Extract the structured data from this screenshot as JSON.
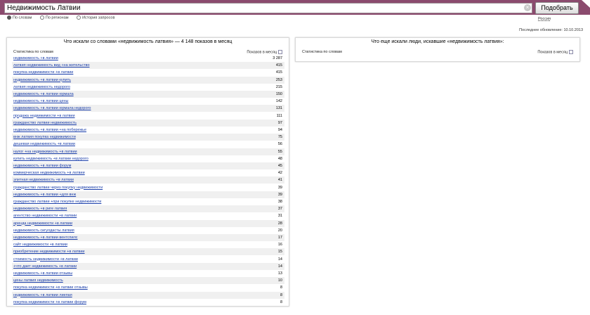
{
  "search": {
    "query": "Недвижимость Латвии",
    "submit_label": "Подобрать",
    "clear_icon": "close-icon"
  },
  "modes": [
    {
      "label": "По словам",
      "selected": true
    },
    {
      "label": "По регионам",
      "selected": false
    },
    {
      "label": "История запросов",
      "selected": false
    }
  ],
  "region": "Россия",
  "updated": "Последнее обновление: 10.10.2013",
  "left": {
    "title": "Что искали со словами «недвижимость латвия» — 4 148 показов в месяц",
    "col_keywords": "Статистика по словам",
    "col_views": "Показов в месяц",
    "export_icon": "export-icon",
    "rows": [
      {
        "keyword": "недвижимость +в латвии",
        "count": "3 287"
      },
      {
        "keyword": "латвия недвижимость вид +на жительство",
        "count": "415"
      },
      {
        "keyword": "покупка недвижимости +в латвии",
        "count": "415"
      },
      {
        "keyword": "недвижимость +в латвии купить",
        "count": "253"
      },
      {
        "keyword": "латвия недвижимость недорого",
        "count": "215"
      },
      {
        "keyword": "недвижимость +в латвии юрмала",
        "count": "150"
      },
      {
        "keyword": "недвижимость +в латвии цены",
        "count": "142"
      },
      {
        "keyword": "недвижимость +в латвии юрмала недорого",
        "count": "131"
      },
      {
        "keyword": "продажа недвижимости +в латвии",
        "count": "111"
      },
      {
        "keyword": "гражданство латвии недвижимость",
        "count": "97"
      },
      {
        "keyword": "недвижимость +в латвии +на побережье",
        "count": "94"
      },
      {
        "keyword": "внж латвия покупка недвижимости",
        "count": "75"
      },
      {
        "keyword": "дешевая недвижимость +в латвии",
        "count": "56"
      },
      {
        "keyword": "налог +на недвижимость +в латвии",
        "count": "55"
      },
      {
        "keyword": "купить недвижимость +в латвии недорого",
        "count": "48"
      },
      {
        "keyword": "недвижимость +в латвии форум",
        "count": "45"
      },
      {
        "keyword": "коммерческая недвижимость +в латвии",
        "count": "42"
      },
      {
        "keyword": "элитная недвижимость +в латвии",
        "count": "41"
      },
      {
        "keyword": "гражданство латвии через покупку недвижимости",
        "count": "39"
      },
      {
        "keyword": "недвижимость +в латвии +для внж",
        "count": "39"
      },
      {
        "keyword": "гражданство латвии +при покупке недвижимости",
        "count": "38"
      },
      {
        "keyword": "недвижимость +в риге латвия",
        "count": "37"
      },
      {
        "keyword": "агентство недвижимости +в латвии",
        "count": "31"
      },
      {
        "keyword": "аренда недвижимости +в латвии",
        "count": "28"
      },
      {
        "keyword": "недвижимость сигулдасты латвия",
        "count": "20"
      },
      {
        "keyword": "недвижимость +в латвии вентспилс",
        "count": "17"
      },
      {
        "keyword": "сайт недвижимости +в латвии",
        "count": "16"
      },
      {
        "keyword": "приобретение недвижимости +в латвии",
        "count": "15"
      },
      {
        "keyword": "стоимость недвижимости +в латвии",
        "count": "14"
      },
      {
        "keyword": "+что дает недвижимость +в латвии",
        "count": "14"
      },
      {
        "keyword": "недвижимость +в латвии отзывы",
        "count": "13"
      },
      {
        "keyword": "цены латвия недвижимость",
        "count": "10"
      },
      {
        "keyword": "покупка недвижимости +в латвии отзывы",
        "count": "8"
      },
      {
        "keyword": "недвижимость +в латвии лиепая",
        "count": "8"
      },
      {
        "keyword": "покупка недвижимости +в латвии форум",
        "count": "8"
      }
    ]
  },
  "right": {
    "title": "Что еще искали люди, искавшие «недвижимость латвия»:",
    "col_keywords": "Статистика по словам",
    "col_views": "Показов в месяц",
    "export_icon": "export-icon"
  }
}
